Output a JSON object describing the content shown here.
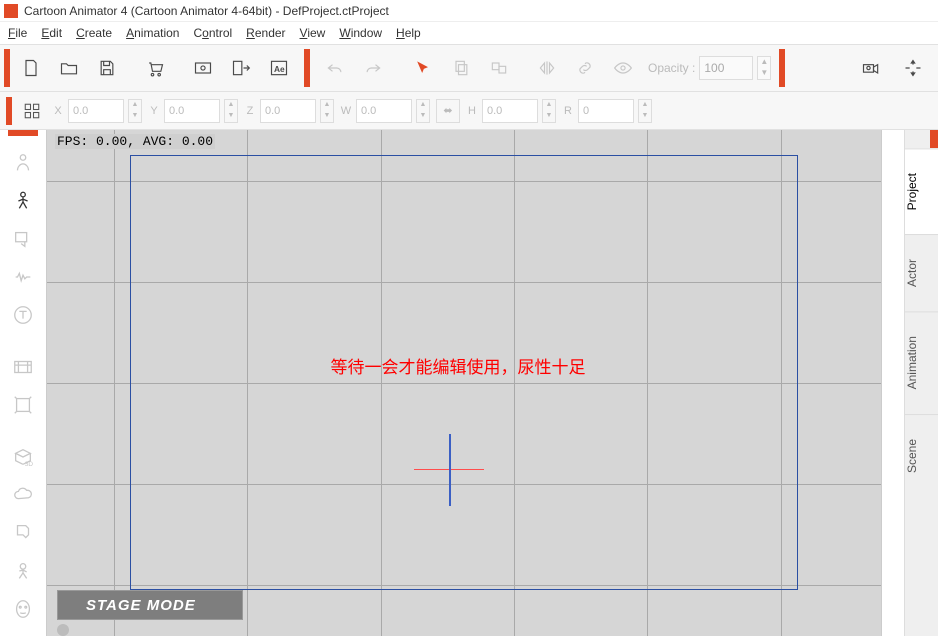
{
  "window": {
    "title": "Cartoon Animator 4  (Cartoon Animator 4-64bit) - DefProject.ctProject"
  },
  "menu": {
    "file": "File",
    "edit": "Edit",
    "create": "Create",
    "animation": "Animation",
    "control": "Control",
    "render": "Render",
    "view": "View",
    "window": "Window",
    "help": "Help"
  },
  "toolbar": {
    "opacity_label": "Opacity :",
    "opacity_value": "100"
  },
  "coords": {
    "x_label": "X",
    "x_value": "0.0",
    "y_label": "Y",
    "y_value": "0.0",
    "z_label": "Z",
    "z_value": "0.0",
    "w_label": "W",
    "w_value": "0.0",
    "h_label": "H",
    "h_value": "0.0",
    "r_label": "R",
    "r_value": "0"
  },
  "canvas": {
    "fps": "FPS: 0.00, AVG: 0.00",
    "overlay_text": "等待一会才能编辑使用，尿性十足",
    "stage_mode": "STAGE MODE"
  },
  "tabs": {
    "project": "Project",
    "actor": "Actor",
    "animation": "Animation",
    "scene": "Scene"
  }
}
